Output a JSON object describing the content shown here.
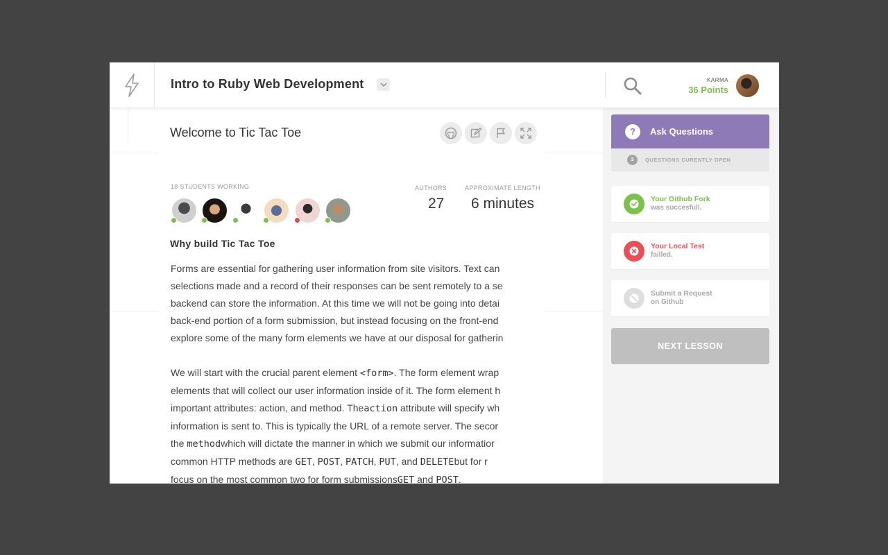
{
  "header": {
    "course_title": "Intro to Ruby Web Development",
    "karma_label": "KARMA",
    "karma_points": "36 Points"
  },
  "lesson": {
    "title": "Welcome to Tic Tac Toe",
    "students_label": "18 STUDENTS WORKING",
    "students": [
      {
        "status": "online",
        "status_color": "#7bc24b"
      },
      {
        "status": "online",
        "status_color": "#7bc24b"
      },
      {
        "status": "online",
        "status_color": "#7bc24b"
      },
      {
        "status": "online",
        "status_color": "#7bc24b"
      },
      {
        "status": "busy",
        "status_color": "#e0474c"
      },
      {
        "status": "online",
        "status_color": "#7bc24b"
      }
    ],
    "authors_label": "AUTHORS",
    "authors_value": "27",
    "length_label": "APPROXIMATE LENGTH",
    "length_value": "6 minutes",
    "section_heading": "Why build Tic Tac Toe",
    "para1": [
      "Forms are essential for gathering user information from site visitors. Text can",
      "selections made and a record of their responses can be sent remotely to a se",
      "backend can store the information. At this time we will not be going into detai",
      "back-end portion of a form submission, but instead focusing on the front-end",
      "explore some of the many form elements we have at our disposal for gatherin"
    ],
    "para2": {
      "l1_a": "We will start with the crucial parent element ",
      "l1_code": "<form>",
      "l1_b": ". The form element wrap",
      "l2": "elements that will collect our user information inside of it. The form element h",
      "l3_a": "important attributes: action, and method. The",
      "l3_code": "action",
      "l3_b": " attribute will specify wh",
      "l4": "information is sent to. This is typically the URL of a remote server. The secor",
      "l5_a": "the ",
      "l5_code": "method",
      "l5_b": "which will dictate the manner in which we submit our informatior",
      "l6_a": "common HTTP methods are ",
      "l6_c1": "GET",
      "l6_s1": ", ",
      "l6_c2": "POST",
      "l6_s2": ", ",
      "l6_c3": "PATCH",
      "l6_s3": ", ",
      "l6_c4": "PUT",
      "l6_s4": ", and ",
      "l6_c5": "DELETE",
      "l6_b": "but for r",
      "l7_a": "focus on the most common two for form submissions",
      "l7_c1": "GET",
      "l7_s1": " and ",
      "l7_c2": "POST",
      "l7_b": "."
    }
  },
  "sidebar": {
    "ask_label": "Ask Questions",
    "ask_icon": "?",
    "open_count": "3",
    "open_label": "QUESTIONS CURENTLY OPEN",
    "steps": [
      {
        "title": "Your Github Fork",
        "subtitle": "was succesfull.",
        "state": "success",
        "color": "#7bc24b"
      },
      {
        "title": "Your Local Test",
        "subtitle": "failled.",
        "state": "failed",
        "color": "#ea4f55"
      },
      {
        "title": "Submit a Request",
        "subtitle": "on Github",
        "state": "disabled",
        "color": "#a8a8a8"
      }
    ],
    "next_label": "NEXT LESSON"
  },
  "colors": {
    "accent_purple": "#8f7ab8",
    "success_green": "#7bc24b",
    "error_red": "#ea4f55",
    "backdrop": "#434343"
  },
  "icons": {
    "logo": "lightning-bolt-icon",
    "dropdown": "chevron-down-icon",
    "search": "search-icon",
    "tools": [
      "github-icon",
      "edit-icon",
      "flag-icon",
      "fullscreen-icon"
    ]
  }
}
